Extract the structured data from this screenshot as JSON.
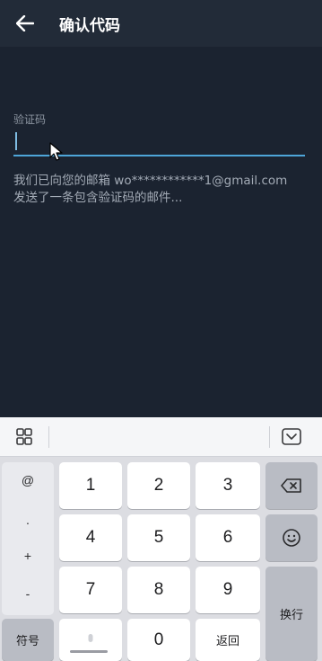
{
  "header": {
    "title": "确认代码",
    "back_icon": "arrow-left-icon"
  },
  "form": {
    "label": "验证码",
    "value": "",
    "info_line1": "我们已向您的邮箱 wo************1@gmail.com",
    "info_line2": "发送了一条包含验证码的邮件..."
  },
  "keyboard": {
    "toolbar": {
      "grid_icon": "grid-icon",
      "hide_icon": "keyboard-hide-icon"
    },
    "side_symbols": [
      "@",
      ".",
      "+",
      "-"
    ],
    "digits": [
      "1",
      "2",
      "3",
      "4",
      "5",
      "6",
      "7",
      "8",
      "9",
      "0"
    ],
    "symbols_label": "符号",
    "return_label": "返回",
    "enter_label": "换行",
    "backspace_icon": "backspace-icon",
    "emoji_icon": "emoji-icon",
    "mic_icon": "microphone-icon"
  }
}
